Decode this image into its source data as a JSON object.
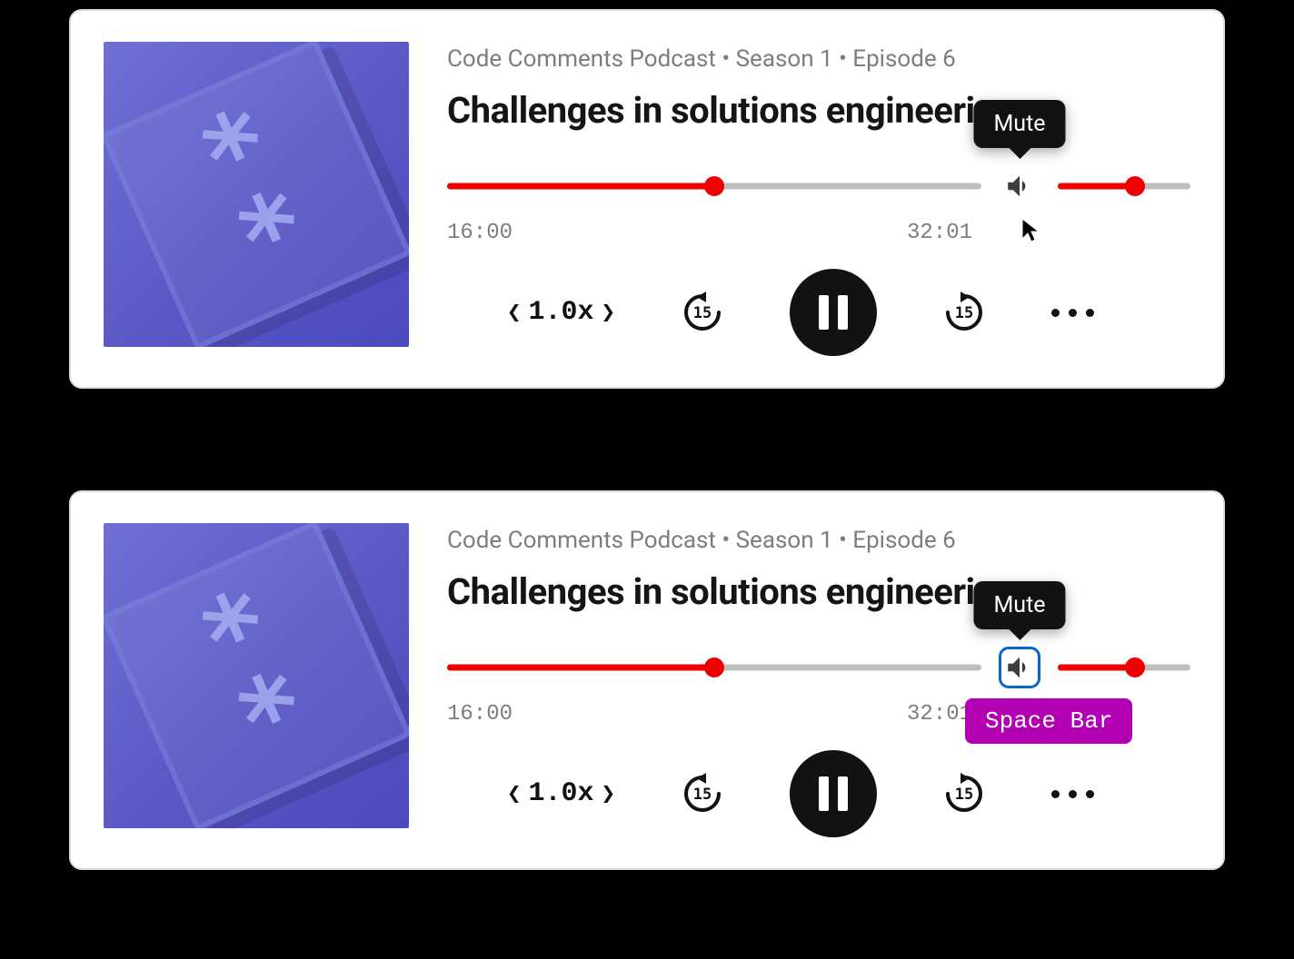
{
  "player": {
    "breadcrumb": "Code Comments Podcast • Season 1 • Episode 6",
    "title": "Challenges in solutions engineering",
    "elapsed": "16:00",
    "duration": "32:01",
    "progress_percent": 50,
    "volume_percent": 58,
    "speed_label": "1.0x",
    "skip_seconds": "15",
    "tooltip_mute": "Mute"
  },
  "keyboard_hint": "Space Bar",
  "colors": {
    "accent": "#ee0000",
    "focus": "#0766cc",
    "hint": "#b200b2"
  }
}
